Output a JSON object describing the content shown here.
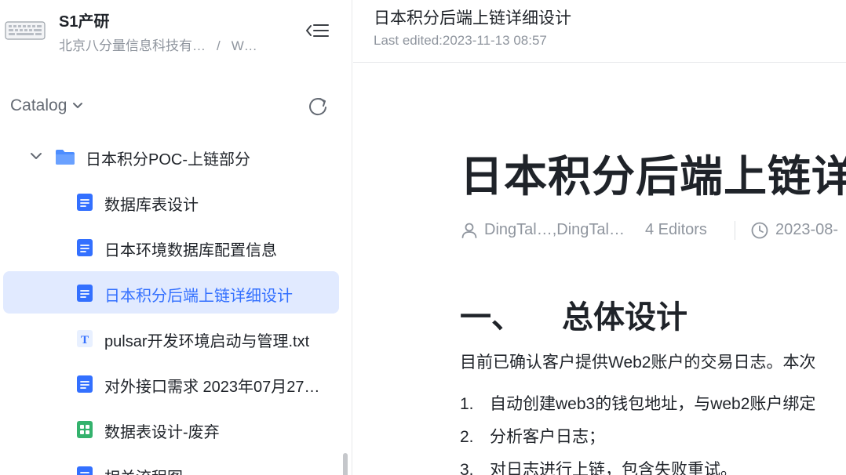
{
  "workspace": {
    "name": "S1产研",
    "org": "北京八分量信息科技有…",
    "path_sep": "/",
    "path_tail": "W…"
  },
  "catalog": {
    "label": "Catalog"
  },
  "tree": {
    "folder": {
      "label": "日本积分POC-上链部分"
    },
    "items": [
      {
        "label": "数据库表设计",
        "icon": "doc-icon"
      },
      {
        "label": "日本环境数据库配置信息",
        "icon": "doc-icon"
      },
      {
        "label": "日本积分后端上链详细设计",
        "icon": "doc-icon",
        "active": true
      },
      {
        "label": "pulsar开发环境启动与管理.txt",
        "icon": "txt-icon"
      },
      {
        "label": "对外接口需求 2023年07月27…",
        "icon": "doc-icon"
      },
      {
        "label": "数据表设计-废弃",
        "icon": "sheet-icon"
      },
      {
        "label": "相关流程图",
        "icon": "doc-icon"
      }
    ]
  },
  "header": {
    "title": "日本积分后端上链详细设计",
    "edited": "Last edited:2023-11-13 08:57"
  },
  "doc": {
    "title": "日本积分后端上链详细设计",
    "authors": "DingTal…,DingTal…",
    "editors": "4 Editors",
    "date": "2023-08-",
    "section_num": "一、",
    "section_title": "总体设计",
    "paragraph": "目前已确认客户提供Web2账户的交易日志。本次",
    "list": [
      {
        "n": "1.",
        "text": "自动创建web3的钱包地址，与web2账户绑定"
      },
      {
        "n": "2.",
        "text": "分析客户日志；"
      },
      {
        "n": "3.",
        "text": "对日志进行上链，包含失败重试。"
      }
    ]
  },
  "colors": {
    "accent": "#3370ff",
    "active_bg": "#e1eaff",
    "doc_icon": "#3370ff",
    "sheet_icon": "#34b26d",
    "folder_icon": "#4c8dff"
  }
}
